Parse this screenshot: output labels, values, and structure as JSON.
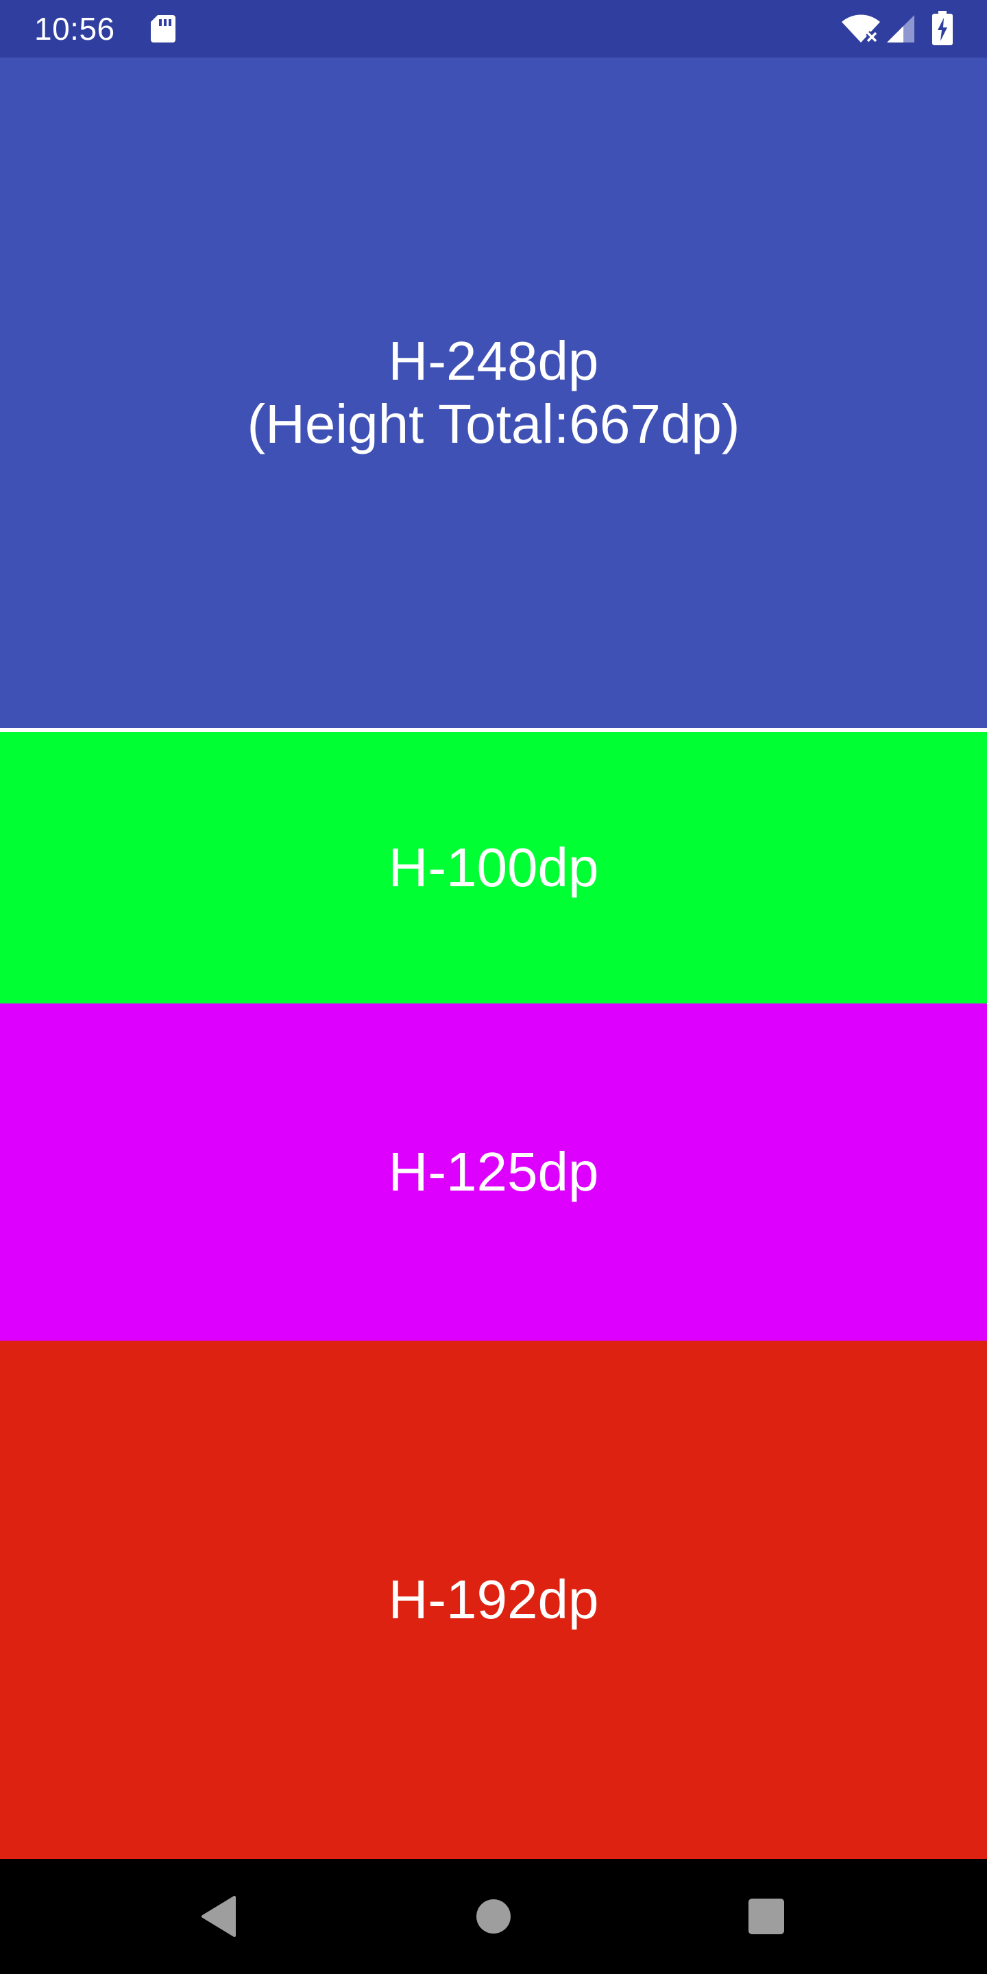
{
  "status_bar": {
    "time": "10:56",
    "icons": [
      "sd-card-icon",
      "wifi-no-internet-icon",
      "cell-signal-icon",
      "battery-charging-icon"
    ],
    "background_color": "#303f9f"
  },
  "blocks": [
    {
      "label": "H-248dp\n(Height Total:667dp)",
      "color": "#3f51b5"
    },
    {
      "label": "H-100dp",
      "color": "#00ff33"
    },
    {
      "label": "H-125dp",
      "color": "#dd00ff"
    },
    {
      "label": "H-192dp",
      "color": "#dd2211"
    }
  ],
  "nav_bar": {
    "buttons": [
      "back-icon",
      "home-icon",
      "recents-icon"
    ]
  }
}
